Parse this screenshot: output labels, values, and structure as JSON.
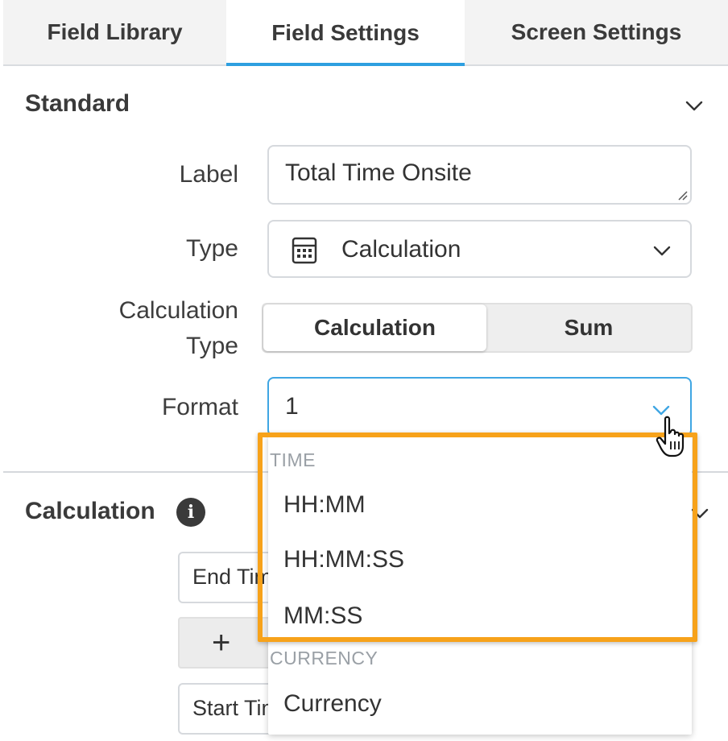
{
  "tabs": [
    {
      "label": "Field Library"
    },
    {
      "label": "Field Settings",
      "active": true
    },
    {
      "label": "Screen Settings"
    }
  ],
  "standard": {
    "title": "Standard",
    "label_field": {
      "label": "Label",
      "value": "Total Time Onsite"
    },
    "type_field": {
      "label": "Type",
      "value": "Calculation",
      "icon": "calculator-icon"
    },
    "calc_type": {
      "label_line1": "Calculation",
      "label_line2": "Type",
      "options": [
        "Calculation",
        "Sum"
      ],
      "selected": "Calculation"
    },
    "format_field": {
      "label": "Format",
      "value": "1"
    }
  },
  "calculation": {
    "title": "Calculation",
    "row1": "End Time",
    "plus": "+",
    "row2": "Start Time"
  },
  "dropdown": {
    "groups": [
      {
        "label": "TIME",
        "options": [
          "HH:MM",
          "HH:MM:SS",
          "MM:SS"
        ]
      },
      {
        "label": "CURRENCY",
        "options": [
          "Currency"
        ]
      }
    ]
  },
  "colors": {
    "accent": "#2e9fe0",
    "highlight": "#f7a21a"
  }
}
